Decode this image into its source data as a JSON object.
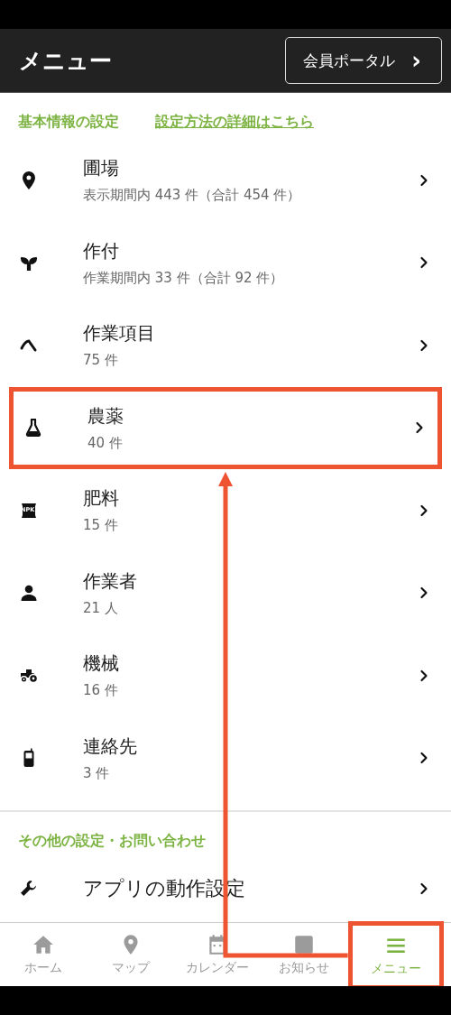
{
  "header": {
    "title": "メニュー",
    "portal_button": {
      "label": "会員ポータル",
      "chevron": "›"
    }
  },
  "section_basic": {
    "title": "基本情報の設定",
    "link": "設定方法の詳細はこちら"
  },
  "items": [
    {
      "title": "圃場",
      "sub": "表示期間内 443 件（合計 454 件）",
      "highlighted": false
    },
    {
      "title": "作付",
      "sub": "作業期間内 33 件（合計 92 件）",
      "highlighted": false
    },
    {
      "title": "作業項目",
      "sub": "75 件",
      "highlighted": false
    },
    {
      "title": "農薬",
      "sub": "40 件",
      "highlighted": true
    },
    {
      "title": "肥料",
      "sub": "15 件",
      "badge": "NPK",
      "highlighted": false
    },
    {
      "title": "作業者",
      "sub": "21 人",
      "highlighted": false
    },
    {
      "title": "機械",
      "sub": "16 件",
      "highlighted": false
    },
    {
      "title": "連絡先",
      "sub": "3 件",
      "highlighted": false
    }
  ],
  "section_other": {
    "title": "その他の設定・お問い合わせ"
  },
  "other_items": [
    {
      "title": "アプリの動作設定"
    }
  ],
  "nav": [
    {
      "label": "ホーム",
      "selected": false,
      "highlighted": false
    },
    {
      "label": "マップ",
      "selected": false,
      "highlighted": false
    },
    {
      "label": "カレンダー",
      "selected": false,
      "highlighted": false
    },
    {
      "label": "お知らせ",
      "selected": false,
      "highlighted": false
    },
    {
      "label": "メニュー",
      "selected": true,
      "highlighted": true
    }
  ]
}
